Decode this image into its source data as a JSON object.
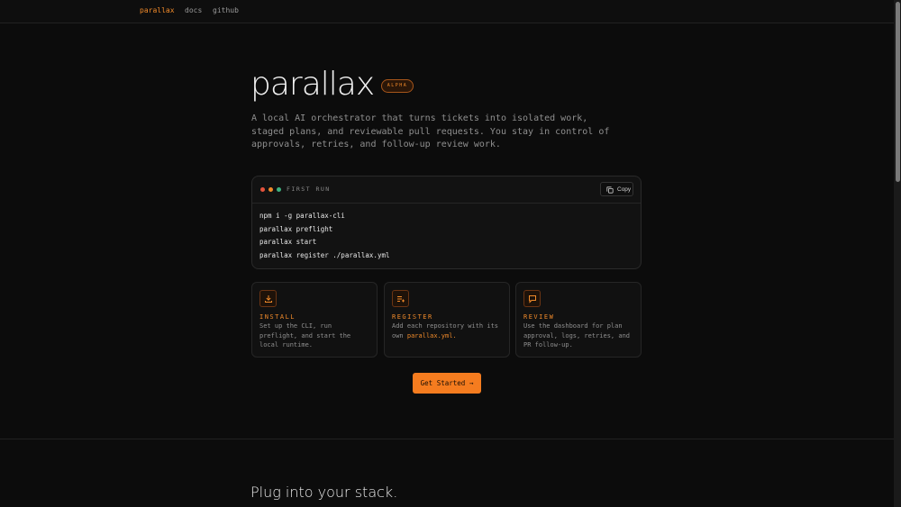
{
  "nav": {
    "brand": "parallax",
    "links": [
      "docs",
      "github"
    ]
  },
  "hero": {
    "title": "parallax",
    "badge": "ALPHA",
    "description": "A local AI orchestrator that turns tickets into isolated work, staged plans, and reviewable pull requests. You stay in control of approvals, retries, and follow-up review work."
  },
  "terminal": {
    "label": "FIRST RUN",
    "copy_label": "Copy",
    "lines": [
      "npm i -g parallax-cli",
      "parallax preflight",
      "parallax start",
      "parallax register ./parallax.yml"
    ],
    "dot_colors": [
      "#e5533d",
      "#f08a2a",
      "#3fb27f"
    ]
  },
  "cards": [
    {
      "icon": "download-icon",
      "title": "INSTALL",
      "text": "Set up the CLI, run preflight, and start the local runtime."
    },
    {
      "icon": "list-add-icon",
      "title": "REGISTER",
      "text": "Add each repository with its own",
      "highlight": "parallax.yml",
      "text_after": "."
    },
    {
      "icon": "message-icon",
      "title": "REVIEW",
      "text": "Use the dashboard for plan approval, logs, retries, and PR follow-up."
    }
  ],
  "cta": {
    "label": "Get Started →"
  },
  "section2": {
    "title": "Plug into your stack."
  },
  "colors": {
    "accent": "#f08a2a",
    "background": "#0c0c0c",
    "button": "#f57c1f"
  }
}
